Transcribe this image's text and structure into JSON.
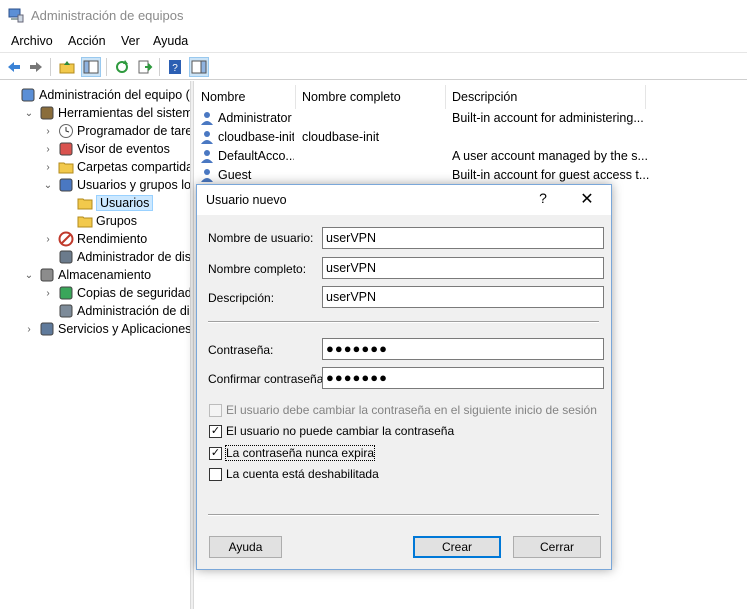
{
  "window": {
    "title": "Administración de equipos",
    "icon": "computer-management-icon"
  },
  "menu": [
    "Archivo",
    "Acción",
    "Ver",
    "Ayuda"
  ],
  "toolbar": [
    "back-arrow-icon",
    "forward-arrow-icon",
    "up-folder-icon",
    "show-hide-tree-icon",
    "refresh-icon",
    "export-list-icon",
    "help-icon",
    "show-hide-action-pane-icon"
  ],
  "tree": [
    {
      "label": "Administración del equipo (loc",
      "level": 0,
      "expander": "",
      "icon": "computer-icon"
    },
    {
      "label": "Herramientas del sistema",
      "level": 1,
      "expander": "⌄",
      "icon": "tools-icon"
    },
    {
      "label": "Programador de tareas",
      "level": 2,
      "expander": "›",
      "icon": "clock-icon"
    },
    {
      "label": "Visor de eventos",
      "level": 2,
      "expander": "›",
      "icon": "event-viewer-icon"
    },
    {
      "label": "Carpetas compartidas",
      "level": 2,
      "expander": "›",
      "icon": "shared-folder-icon"
    },
    {
      "label": "Usuarios y grupos locale",
      "level": 2,
      "expander": "⌄",
      "icon": "users-icon"
    },
    {
      "label": "Usuarios",
      "level": 3,
      "expander": "",
      "icon": "folder-icon",
      "selected": true
    },
    {
      "label": "Grupos",
      "level": 3,
      "expander": "",
      "icon": "folder-icon"
    },
    {
      "label": "Rendimiento",
      "level": 2,
      "expander": "›",
      "icon": "performance-icon"
    },
    {
      "label": "Administrador de dispo",
      "level": 2,
      "expander": "",
      "icon": "device-manager-icon"
    },
    {
      "label": "Almacenamiento",
      "level": 1,
      "expander": "⌄",
      "icon": "storage-icon"
    },
    {
      "label": "Copias de seguridad de",
      "level": 2,
      "expander": "›",
      "icon": "backup-icon"
    },
    {
      "label": "Administración de disco",
      "level": 2,
      "expander": "",
      "icon": "disk-icon"
    },
    {
      "label": "Servicios y Aplicaciones",
      "level": 1,
      "expander": "›",
      "icon": "services-icon"
    }
  ],
  "list": {
    "columns": [
      "Nombre",
      "Nombre completo",
      "Descripción"
    ],
    "rows": [
      {
        "name": "Administrator",
        "fullname": "",
        "desc": "Built-in account for administering..."
      },
      {
        "name": "cloudbase-init",
        "fullname": "cloudbase-init",
        "desc": ""
      },
      {
        "name": "DefaultAcco...",
        "fullname": "",
        "desc": "A user account managed by the s..."
      },
      {
        "name": "Guest",
        "fullname": "",
        "desc": "Built-in account for guest access t..."
      }
    ]
  },
  "dialog": {
    "title": "Usuario nuevo",
    "help": "?",
    "close": "✕",
    "fields": {
      "username": {
        "label": "Nombre de usuario:",
        "value": "userVPN"
      },
      "fullname": {
        "label": "Nombre completo:",
        "value": "userVPN"
      },
      "description": {
        "label": "Descripción:",
        "value": "userVPN"
      },
      "password": {
        "label": "Contraseña:",
        "value": "●●●●●●●"
      },
      "confirm": {
        "label": "Confirmar contraseña:",
        "value": "●●●●●●●"
      }
    },
    "checkboxes": [
      {
        "label": "El usuario debe cambiar la contraseña en el siguiente inicio de sesión",
        "checked": false,
        "disabled": true
      },
      {
        "label": "El usuario no puede cambiar la contraseña",
        "checked": true,
        "disabled": false
      },
      {
        "label": "La contraseña nunca expira",
        "checked": true,
        "disabled": false,
        "focused": true
      },
      {
        "label": "La cuenta está deshabilitada",
        "checked": false,
        "disabled": false
      }
    ],
    "buttons": {
      "help": "Ayuda",
      "create": "Crear",
      "close": "Cerrar"
    }
  }
}
